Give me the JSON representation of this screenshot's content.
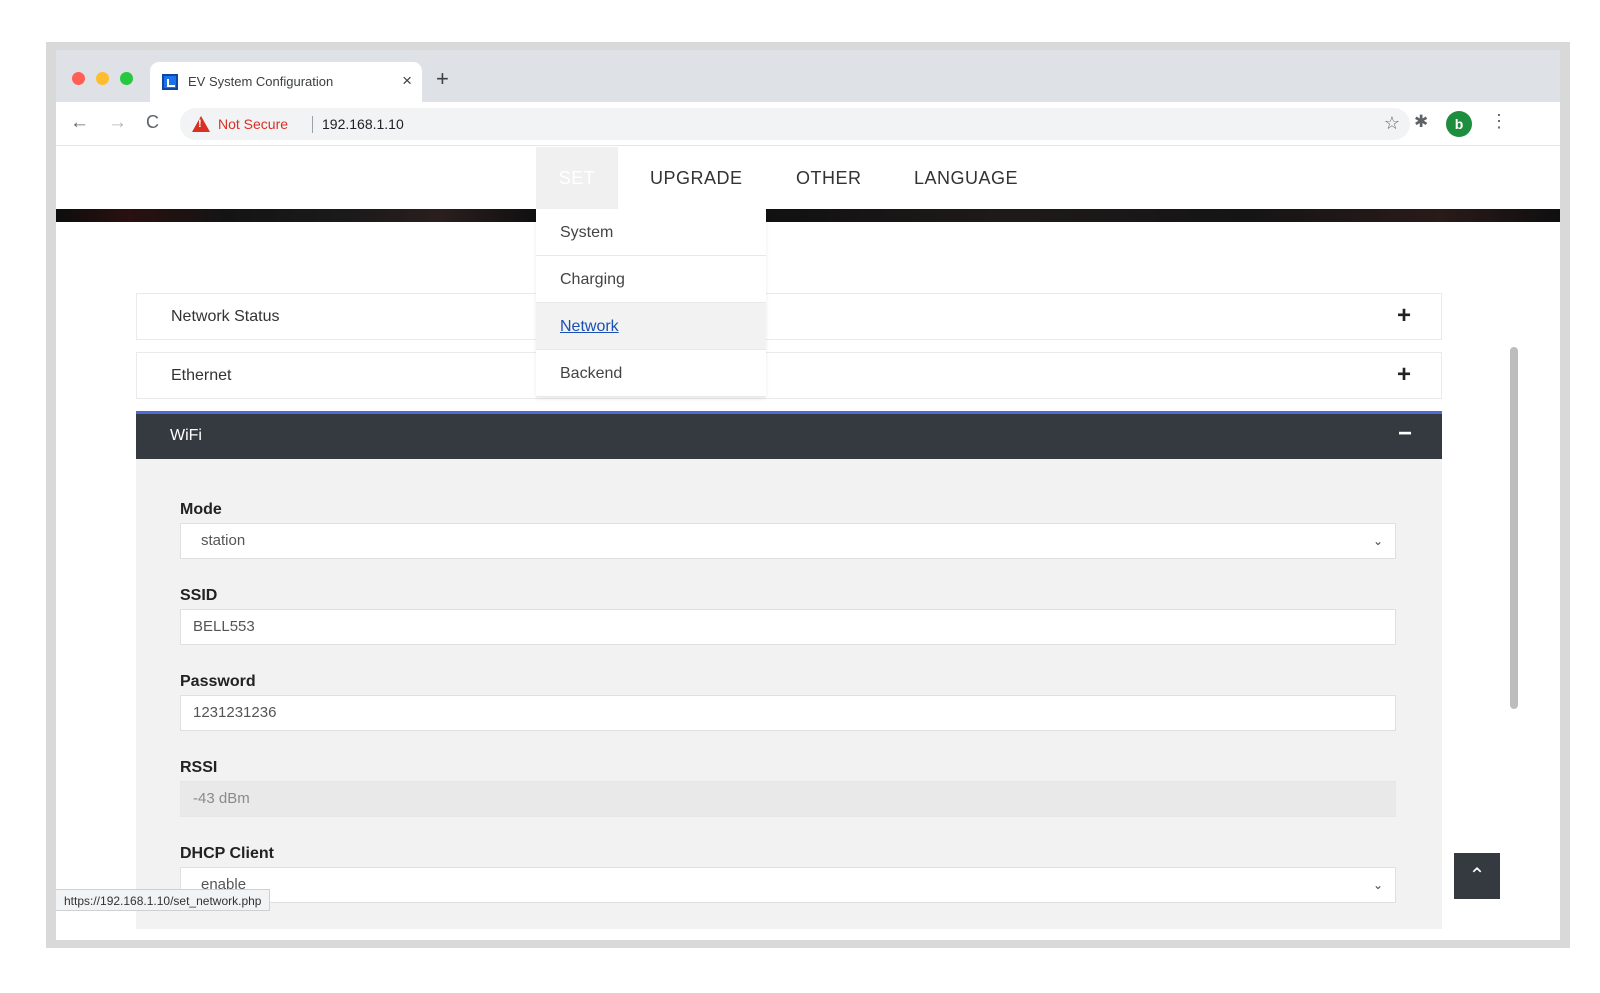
{
  "browser": {
    "tab_title": "EV System Configuration",
    "tab_close": "×",
    "new_tab": "+",
    "back": "←",
    "forward": "→",
    "reload": "C",
    "security_text": "Not Secure",
    "url": "192.168.1.10",
    "bookmark_icon": "☆",
    "extensions_icon": "✱",
    "profile_initial": "b",
    "menu_icon": "⋮"
  },
  "nav": {
    "items": [
      {
        "label": "SET"
      },
      {
        "label": "UPGRADE"
      },
      {
        "label": "OTHER"
      },
      {
        "label": "LANGUAGE"
      }
    ]
  },
  "set_menu": {
    "items": [
      {
        "label": "System"
      },
      {
        "label": "Charging"
      },
      {
        "label": "Network",
        "active": true
      },
      {
        "label": "Backend"
      }
    ]
  },
  "sections": {
    "network_status": {
      "title": "Network Status",
      "toggle": "+"
    },
    "ethernet": {
      "title": "Ethernet",
      "toggle": "+"
    },
    "wifi": {
      "title": "WiFi",
      "toggle": "−"
    }
  },
  "wifi_form": {
    "mode": {
      "label": "Mode",
      "value": "station"
    },
    "ssid": {
      "label": "SSID",
      "value": "BELL553"
    },
    "password": {
      "label": "Password",
      "value": "1231231236"
    },
    "rssi": {
      "label": "RSSI",
      "value": "-43 dBm"
    },
    "dhcp": {
      "label": "DHCP Client",
      "value": "enable"
    },
    "select_caret": "⌄"
  },
  "back_to_top": "⌃",
  "status_bar_url": "https://192.168.1.10/set_network.php",
  "colors": {
    "header_dark": "#343a40",
    "accent_border": "#4f6bd8",
    "link_active": "#1a4fb5",
    "warning": "#d93025"
  }
}
